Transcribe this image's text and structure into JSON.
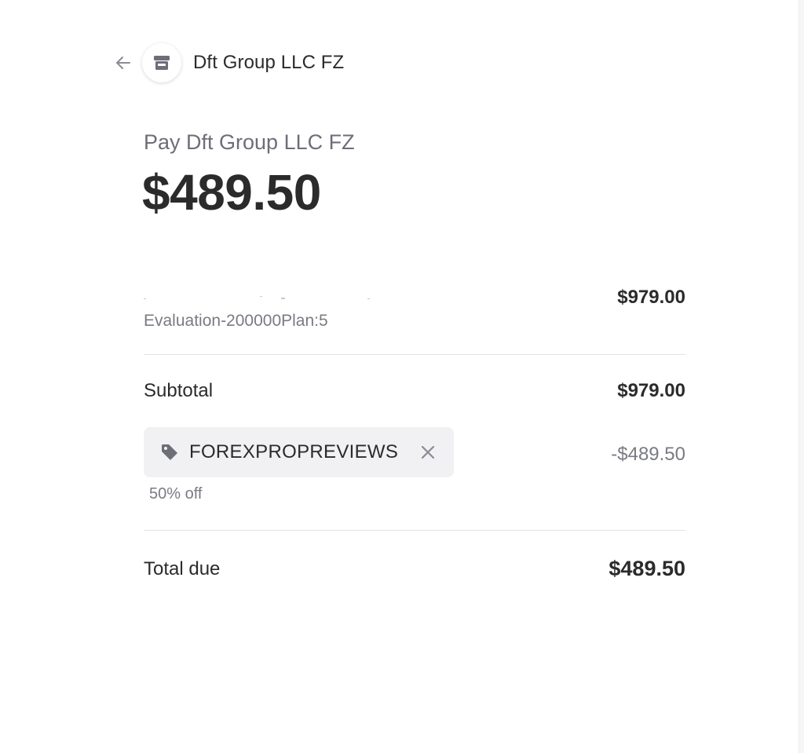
{
  "header": {
    "merchant_name": "Dft Group LLC FZ",
    "back_icon": "arrow-left-icon",
    "avatar_icon": "storefront-icon"
  },
  "payment": {
    "pay_label": "Pay Dft Group LLC FZ",
    "amount": "$489.50"
  },
  "line_item": {
    "description": "Evaluation-200000Plan:5",
    "price": "$979.00"
  },
  "subtotal": {
    "label": "Subtotal",
    "value": "$979.00"
  },
  "promo": {
    "code": "FOREXPROPREVIEWS",
    "discount": "-$489.50",
    "note": "50% off",
    "tag_icon": "tag-icon",
    "remove_icon": "close-icon"
  },
  "total": {
    "label": "Total due",
    "value": "$489.50"
  },
  "colors": {
    "text_primary": "#2b2b2b",
    "text_secondary": "#7a7b83",
    "chip_bg": "#f1f1f3",
    "divider": "#e3e3e6"
  }
}
